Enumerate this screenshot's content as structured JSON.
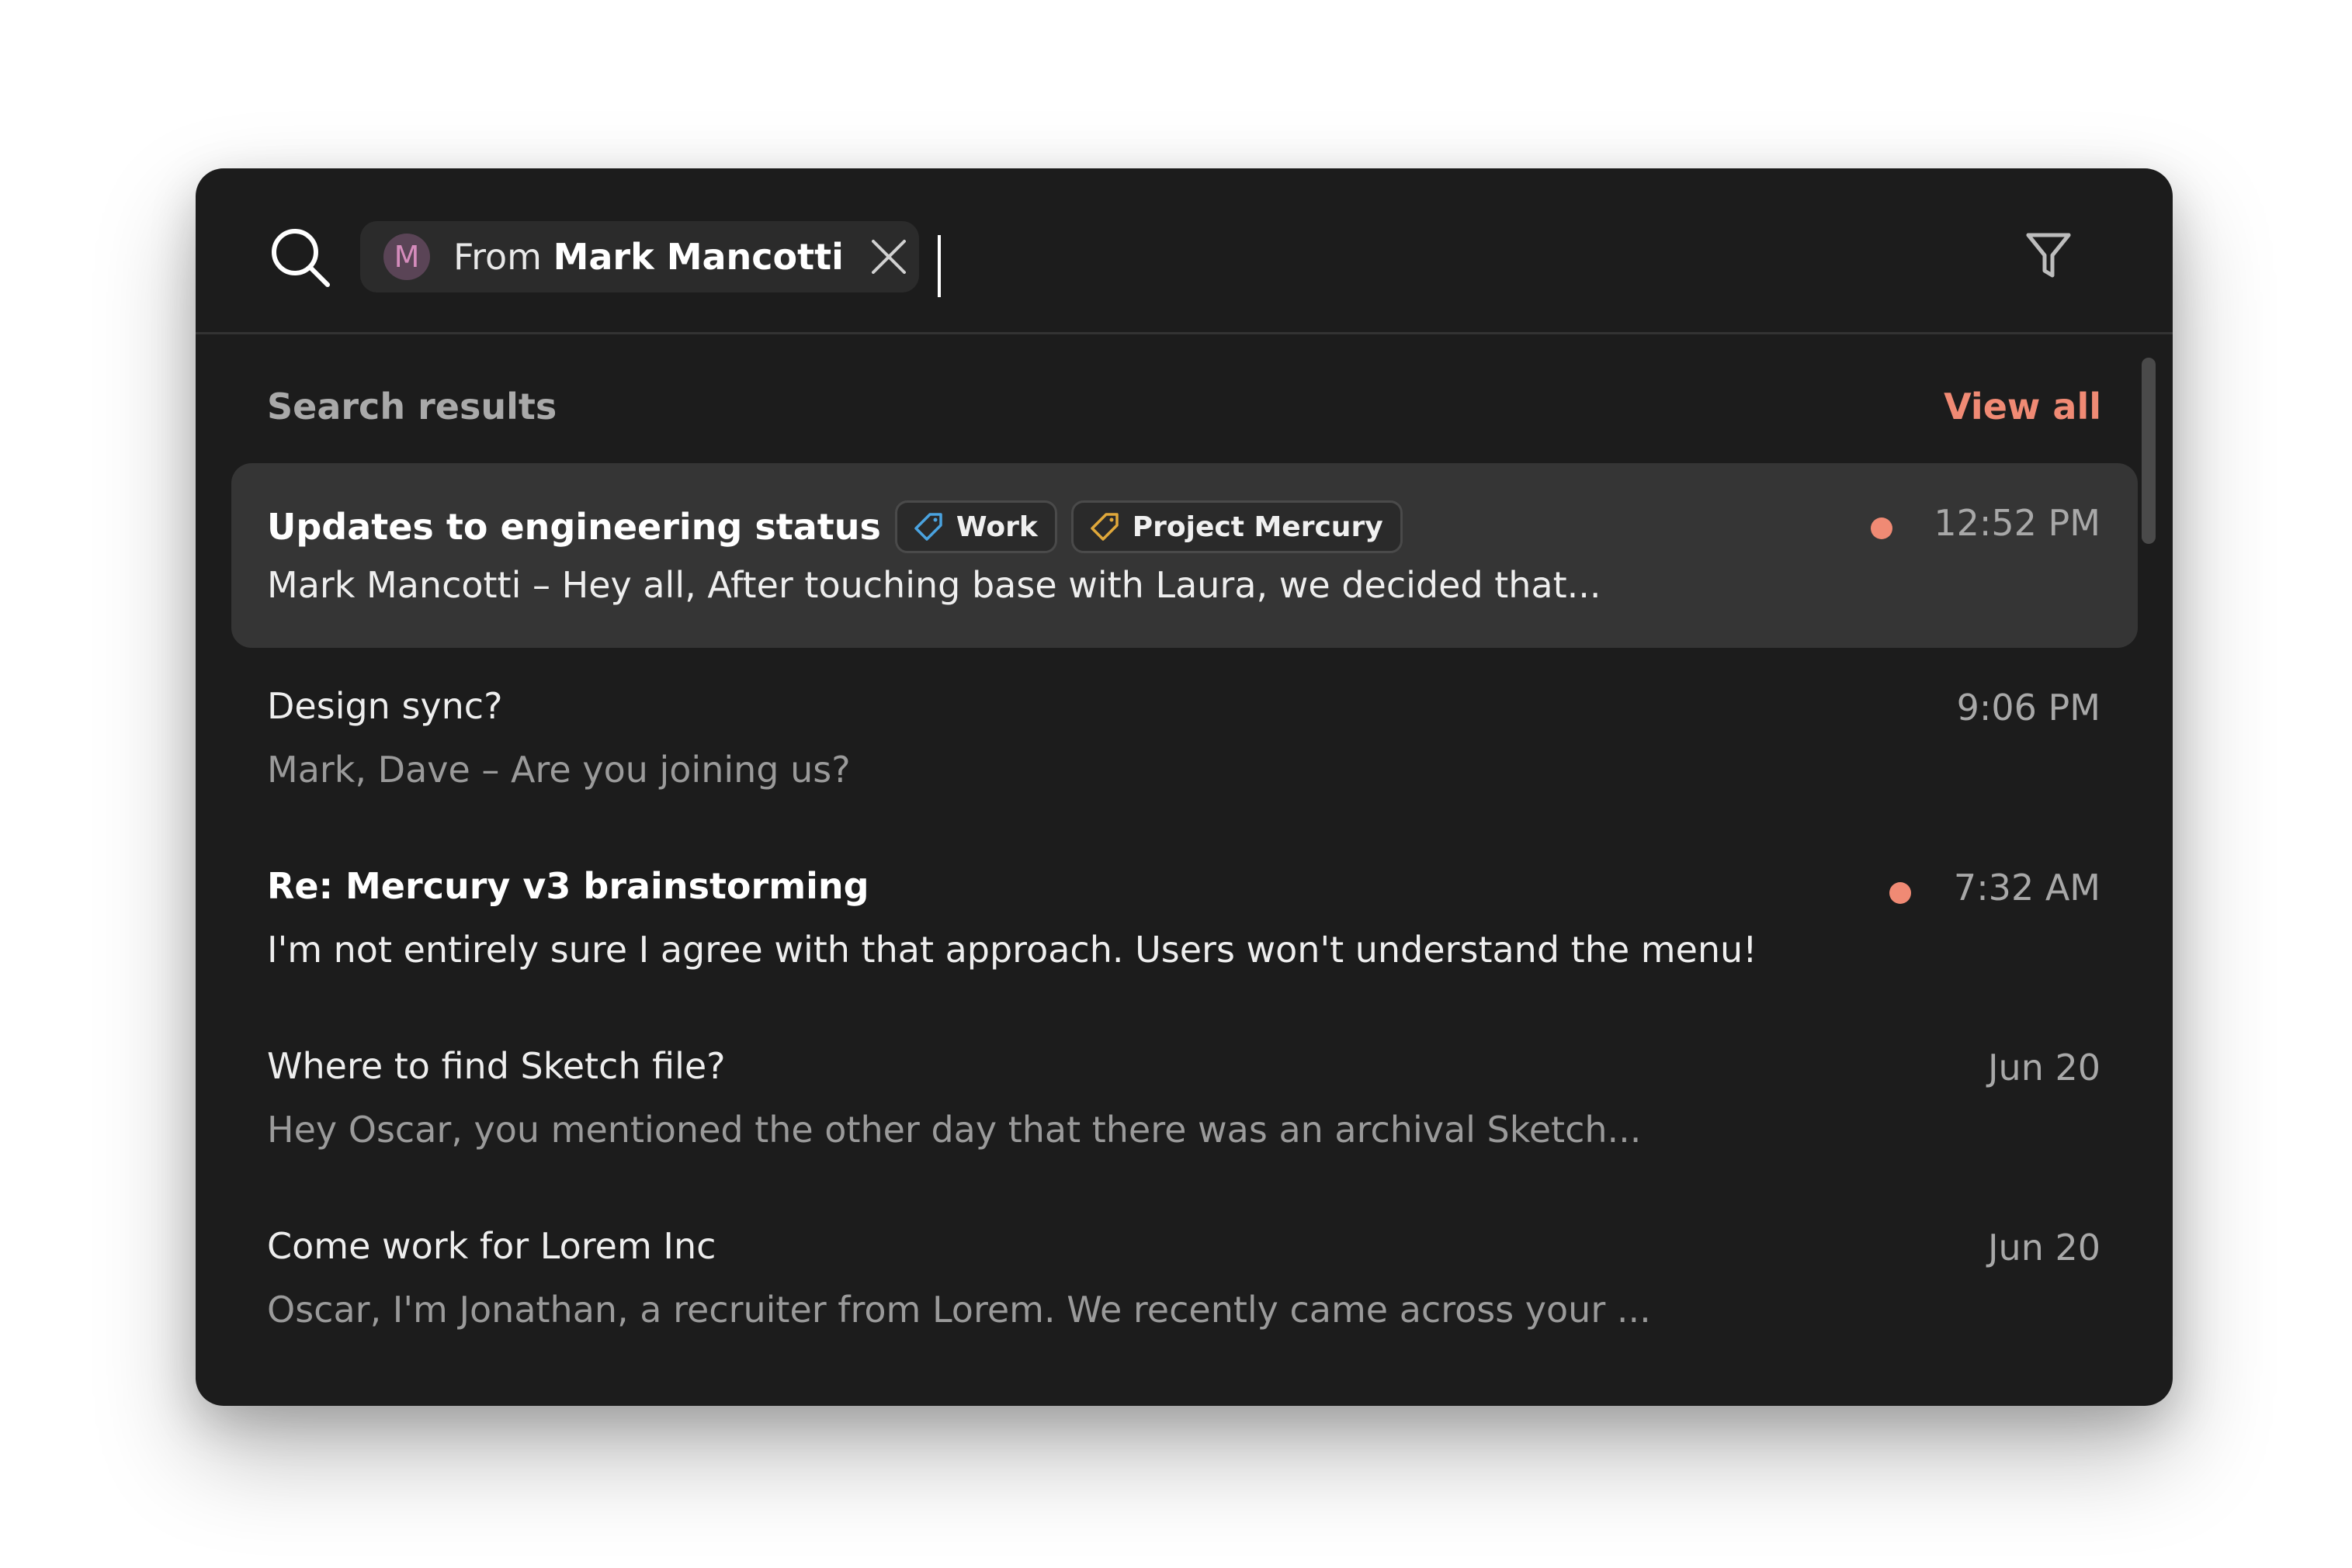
{
  "search": {
    "chip": {
      "avatar_letter": "M",
      "prefix": "From",
      "name": "Mark Mancotti"
    }
  },
  "results_header": {
    "title": "Search results",
    "view_all": "View all"
  },
  "colors": {
    "accent": "#f08a74",
    "work_tag": "#4aa3e0",
    "project_tag": "#e0a83a"
  },
  "results": [
    {
      "title": "Updates to engineering status",
      "tags": [
        "Work",
        "Project Mercury"
      ],
      "preview": "Mark Mancotti – Hey all, After touching base with Laura, we decided that...",
      "time": "12:52 PM",
      "unread": true,
      "selected": true
    },
    {
      "title": "Design sync?",
      "preview": "Mark, Dave – Are you joining us?",
      "time": "9:06 PM",
      "unread": false
    },
    {
      "title": "Re: Mercury v3 brainstorming",
      "preview": "I'm not entirely sure I agree with that approach. Users won't understand the menu!",
      "time": "7:32 AM",
      "unread": true
    },
    {
      "title": "Where to find Sketch file?",
      "preview": "Hey Oscar, you mentioned the other day that there was an archival Sketch...",
      "time": "Jun 20",
      "unread": false
    },
    {
      "title": "Come work for Lorem Inc",
      "preview": "Oscar, I'm Jonathan, a recruiter from Lorem. We recently came across your ...",
      "time": "Jun 20",
      "unread": false
    }
  ]
}
